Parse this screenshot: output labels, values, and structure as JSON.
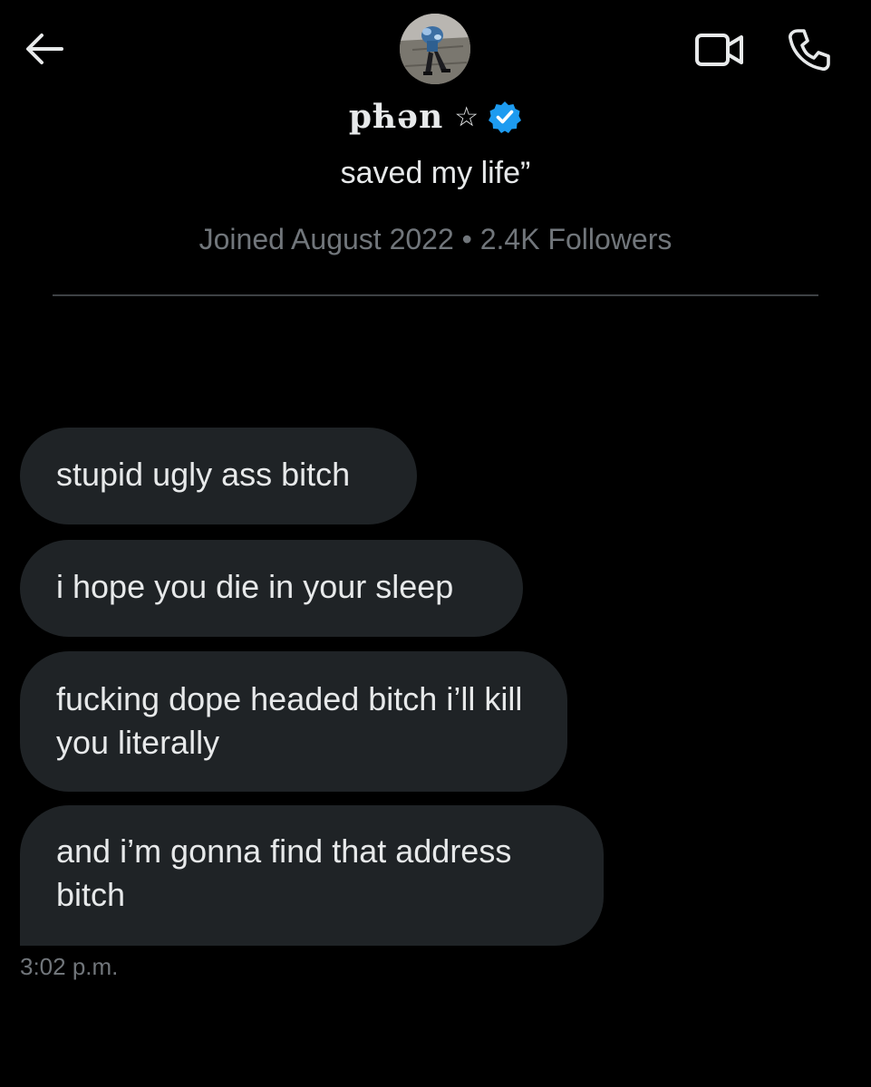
{
  "header": {
    "back_icon": "arrow-left-icon",
    "video_icon": "video-camera-icon",
    "call_icon": "phone-icon"
  },
  "profile": {
    "display_name": "pћən",
    "name_suffix": "☆",
    "verified_color": "#1d9bf0",
    "bio": "saved my life”",
    "meta": "Joined August 2022 • 2.4K Followers"
  },
  "messages": [
    {
      "text": "stupid ugly ass bitch"
    },
    {
      "text": "i hope you die in your sleep"
    },
    {
      "text": "fucking dope headed bitch i’ll kill you literally"
    },
    {
      "text": "and i’m gonna find that address bitch"
    }
  ],
  "timestamp": "3:02 p.m.",
  "colors": {
    "background": "#000000",
    "bubble": "#1f2326",
    "text": "#e7e9ea",
    "secondary_text": "#71767b",
    "accent": "#1d9bf0"
  }
}
